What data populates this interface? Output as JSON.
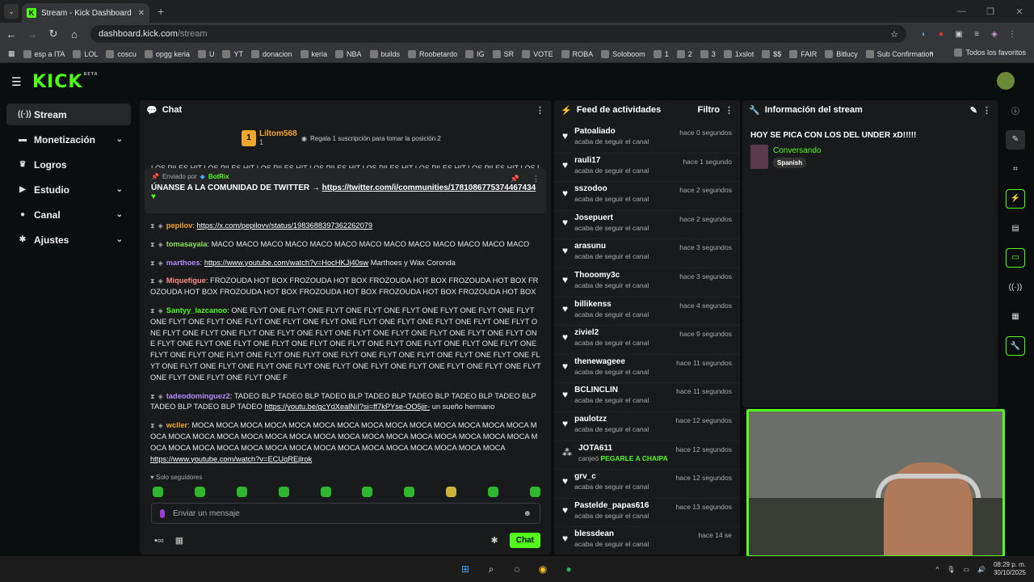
{
  "browser": {
    "tab_title": "Stream - Kick Dashboard",
    "url_host": "dashboard.kick.com",
    "url_path": "/stream",
    "bookmarks": [
      "esp a ITA",
      "LOL",
      "coscu",
      "opgg keria",
      "U",
      "YT",
      "donacion",
      "keria",
      "NBA",
      "builds",
      "Roobetardo",
      "IG",
      "SR",
      "VOTE",
      "ROBA",
      "Soloboom",
      "1",
      "2",
      "3",
      "1xslot",
      "$$",
      "FAIR",
      "Bitlucy",
      "Sub Confirmation"
    ],
    "all_bookmarks": "Todos los favoritos"
  },
  "kick": {
    "logo": "KICK",
    "beta": "BETA"
  },
  "sidebar": {
    "items": [
      {
        "label": "Stream",
        "icon": "broadcast-icon"
      },
      {
        "label": "Monetización",
        "icon": "money-icon"
      },
      {
        "label": "Logros",
        "icon": "trophy-icon"
      },
      {
        "label": "Estudio",
        "icon": "video-icon"
      },
      {
        "label": "Canal",
        "icon": "user-icon"
      },
      {
        "label": "Ajustes",
        "icon": "gear-icon"
      }
    ]
  },
  "chat": {
    "title": "Chat",
    "leader_name": "Liltom568",
    "leader_rank": "1",
    "leader_count": "1",
    "gift_prompt": "Regala 1 suscripción para tomar la posición 2",
    "marquee": "LOS PILES HIT LOS PILES HIT LOS PILES HIT LOS PILES HIT LOS PILES HIT LOS PILES HIT LOS PILES HIT LOS PILES HIT LOS PILES",
    "pinned_by_label": "Enviado por",
    "pinned_by": "BotRix",
    "pinned_text": "ÚNANSE A LA COMUNIDAD DE TWITTER → ",
    "pinned_link": "https://twitter.com/i/communities/1781086775374467434",
    "messages": [
      {
        "user": "pepilov",
        "color": "#f2a72b",
        "text": "",
        "link": "https://x.com/pepilovv/status/1983688397362262079"
      },
      {
        "user": "tomasayala",
        "color": "#8fe35a",
        "text": "MACO MACO MACO MACO MACO MACO MACO MACO MACO MACO MACO MACO MACO",
        "link": ""
      },
      {
        "user": "marthoes",
        "color": "#b48cff",
        "text": " Marthoes y Wax Coronda",
        "link": "https://www.youtube.com/watch?v=HocHKJj40sw"
      },
      {
        "user": "Miquefigue",
        "color": "#ff8b8b",
        "text": "FROZOUDA HOT BOX FROZOUDA HOT BOX FROZOUDA HOT BOX FROZOUDA HOT BOX FROZOUDA HOT BOX FROZOUDA HOT BOX FROZOUDA HOT BOX FROZOUDA HOT BOX FROZOUDA HOT BOX",
        "link": ""
      },
      {
        "user": "Santyy_lazcanoo",
        "color": "#53fc18",
        "text": "ONE FLYT ONE FLYT ONE FLYT ONE FLYT ONE FLYT ONE FLYT ONE FLYT ONE FLYT ONE FLYT ONE FLYT ONE FLYT ONE FLYT ONE FLYT ONE FLYT ONE FLYT ONE FLYT ONE FLYT ONE FLYT ONE FLYT ONE FLYT ONE FLYT ONE FLYT ONE FLYT ONE FLYT ONE FLYT ONE FLYT ONE FLYT ONE FLYT ONE FLYT ONE FLYT ONE FLYT ONE FLYT ONE FLYT ONE FLYT ONE FLYT ONE FLYT ONE FLYT ONE FLYT ONE FLYT ONE FLYT ONE FLYT ONE FLYT ONE FLYT ONE FLYT ONE FLYT ONE FLYT ONE FLYT ONE FLYT ONE FLYT ONE FLYT ONE FLYT ONE FLYT ONE FLYT ONE FLYT ONE FLYT ONE FLYT ONE FLYT ONE FLYT ONE FLYT ONE FLYT ONE FLYT ONE FLYT ONE F",
        "link": ""
      },
      {
        "user": "tadeodominguez2",
        "color": "#b48cff",
        "text": "TADEO BLP TADEO BLP TADEO BLP TADEO BLP TADEO BLP TADEO BLP TADEO BLP TADEO BLP TADEO BLP TADEO ",
        "link": "https://youtu.be/gcYdXealNiI?si=ff7kPYse-OO5jir-",
        "after": " un sueño hermano"
      },
      {
        "user": "wcller",
        "color": "#f2a72b",
        "text": "MOCA MOCA MOCA MOCA MOCA MOCA MOCA MOCA MOCA MOCA MOCA MOCA MOCA MOCA MOCA MOCA MOCA MOCA MOCA MOCA MOCA MOCA MOCA MOCA MOCA MOCA MOCA MOCA MOCA MOCA MOCA MOCA MOCA MOCA MOCA MOCA MOCA MOCA MOCA MOCA MOCA MOCA MOCA MOCA MOCA",
        "link": "https://www.youtube.com/watch?v=ECUqREjlrok"
      }
    ],
    "followers_only": "Solo seguidores",
    "input_placeholder": "Enviar un mensaje",
    "send_label": "Chat"
  },
  "feed": {
    "title": "Feed de actividades",
    "filter_label": "Filtro",
    "items": [
      {
        "name": "Patoaliado",
        "action": "acaba de seguir el canal",
        "time": "hace 0 segundos"
      },
      {
        "name": "rauli17",
        "action": "acaba de seguir el canal",
        "time": "hace 1 segundo"
      },
      {
        "name": "sszodoo",
        "action": "acaba de seguir el canal",
        "time": "hace 2 segundos"
      },
      {
        "name": "Josepuert",
        "action": "acaba de seguir el canal",
        "time": "hace 2 segundos"
      },
      {
        "name": "arasunu",
        "action": "acaba de seguir el canal",
        "time": "hace 3 segundos"
      },
      {
        "name": "Thooomy3c",
        "action": "acaba de seguir el canal",
        "time": "hace 3 segundos"
      },
      {
        "name": "billikenss",
        "action": "acaba de seguir el canal",
        "time": "hace 4 segundos"
      },
      {
        "name": "ziviel2",
        "action": "acaba de seguir el canal",
        "time": "hace 9 segundos"
      },
      {
        "name": "thenewageee",
        "action": "acaba de seguir el canal",
        "time": "hace 11 segundos"
      },
      {
        "name": "BCLINCLIN",
        "action": "acaba de seguir el canal",
        "time": "hace 11 segundos"
      },
      {
        "name": "paulotzz",
        "action": "acaba de seguir el canal",
        "time": "hace 12 segundos"
      },
      {
        "name": "JOTA611",
        "action": "canjeó",
        "reward": "PEGARLE A CHAIPA",
        "time": "hace 12 segundos"
      },
      {
        "name": "grv_c",
        "action": "acaba de seguir el canal",
        "time": "hace 12 segundos"
      },
      {
        "name": "Pastelde_papas616",
        "action": "acaba de seguir el canal",
        "time": "hace 13 segundos"
      },
      {
        "name": "blessdean",
        "action": "acaba de seguir el canal",
        "time": "hace 14 se"
      }
    ]
  },
  "info": {
    "title": "Información del stream",
    "stream_title": "HOY SE PICA CON LOS DEL UNDER xD!!!!!",
    "category": "Conversando",
    "language": "Spanish"
  },
  "taskbar": {
    "time": "08:29 p. m.",
    "date": "30/10/2025"
  }
}
